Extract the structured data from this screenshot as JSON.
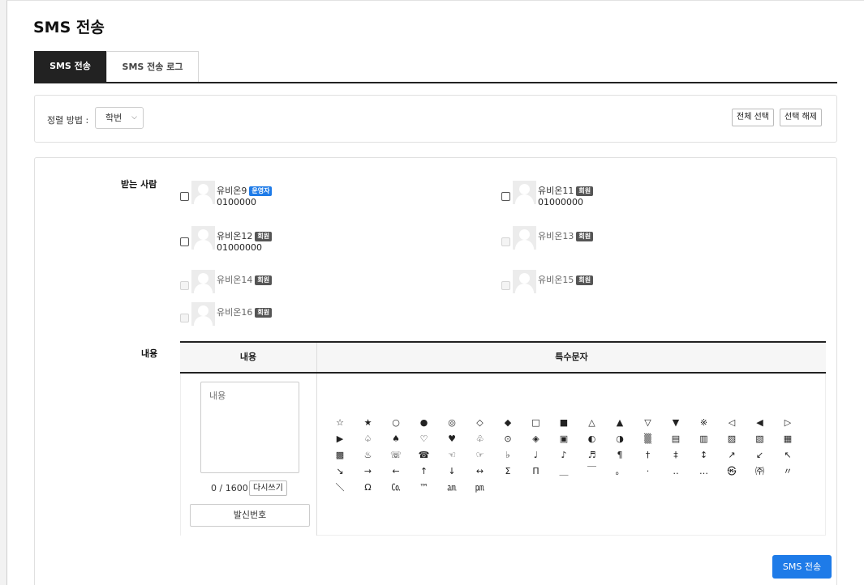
{
  "page": {
    "title": "SMS 전송"
  },
  "tabs": [
    {
      "label": "SMS 전송",
      "active": true
    },
    {
      "label": "SMS 전송 로그",
      "active": false
    }
  ],
  "sort": {
    "label": "정렬 방법 :",
    "selected": "학번",
    "select_all": "전체 선택",
    "deselect": "선택 해제"
  },
  "recipients_label": "받는 사람",
  "recipients": [
    {
      "name": "유비온9",
      "badge": "운영자",
      "badge_type": "op",
      "phone": "0100000",
      "enabled": true
    },
    {
      "name": "유비온11",
      "badge": "회원",
      "badge_type": "mem",
      "phone": "01000000",
      "enabled": true
    },
    {
      "name": "유비온12",
      "badge": "회원",
      "badge_type": "mem",
      "phone": "01000000",
      "enabled": true
    },
    {
      "name": "유비온13",
      "badge": "회원",
      "badge_type": "mem",
      "phone": "",
      "enabled": false
    },
    {
      "name": "유비온14",
      "badge": "회원",
      "badge_type": "mem",
      "phone": "",
      "enabled": false
    },
    {
      "name": "유비온15",
      "badge": "회원",
      "badge_type": "mem",
      "phone": "",
      "enabled": false
    },
    {
      "name": "유비온16",
      "badge": "회원",
      "badge_type": "mem",
      "phone": "",
      "enabled": false
    }
  ],
  "content": {
    "row_label": "내용",
    "col_content": "내용",
    "col_special": "특수문자",
    "placeholder": "내용",
    "counter": "0 / 1600",
    "reset_label": "다시쓰기",
    "sender_label": "발신번호"
  },
  "special_chars": [
    "☆",
    "★",
    "○",
    "●",
    "◎",
    "◇",
    "◆",
    "□",
    "■",
    "△",
    "▲",
    "▽",
    "▼",
    "※",
    "◁",
    "◀",
    "▷",
    "▶",
    "♤",
    "♠",
    "♡",
    "♥",
    "♧",
    "⊙",
    "◈",
    "▣",
    "◐",
    "◑",
    "▒",
    "▤",
    "▥",
    "▨",
    "▧",
    "▦",
    "▩",
    "♨",
    "☏",
    "☎",
    "☜",
    "☞",
    "♭",
    "♩",
    "♪",
    "♬",
    "¶",
    "†",
    "‡",
    "↕",
    "↗",
    "↙",
    "↖",
    "↘",
    "→",
    "←",
    "↑",
    "↓",
    "↔",
    "Σ",
    "Π",
    "＿",
    "￣",
    "。",
    "·",
    "‥",
    "…",
    "㉿",
    "㈜",
    "〃",
    "＼",
    "Ω",
    "㏇",
    "™",
    "㏂",
    "㏘"
  ],
  "send_label": "SMS 전송"
}
